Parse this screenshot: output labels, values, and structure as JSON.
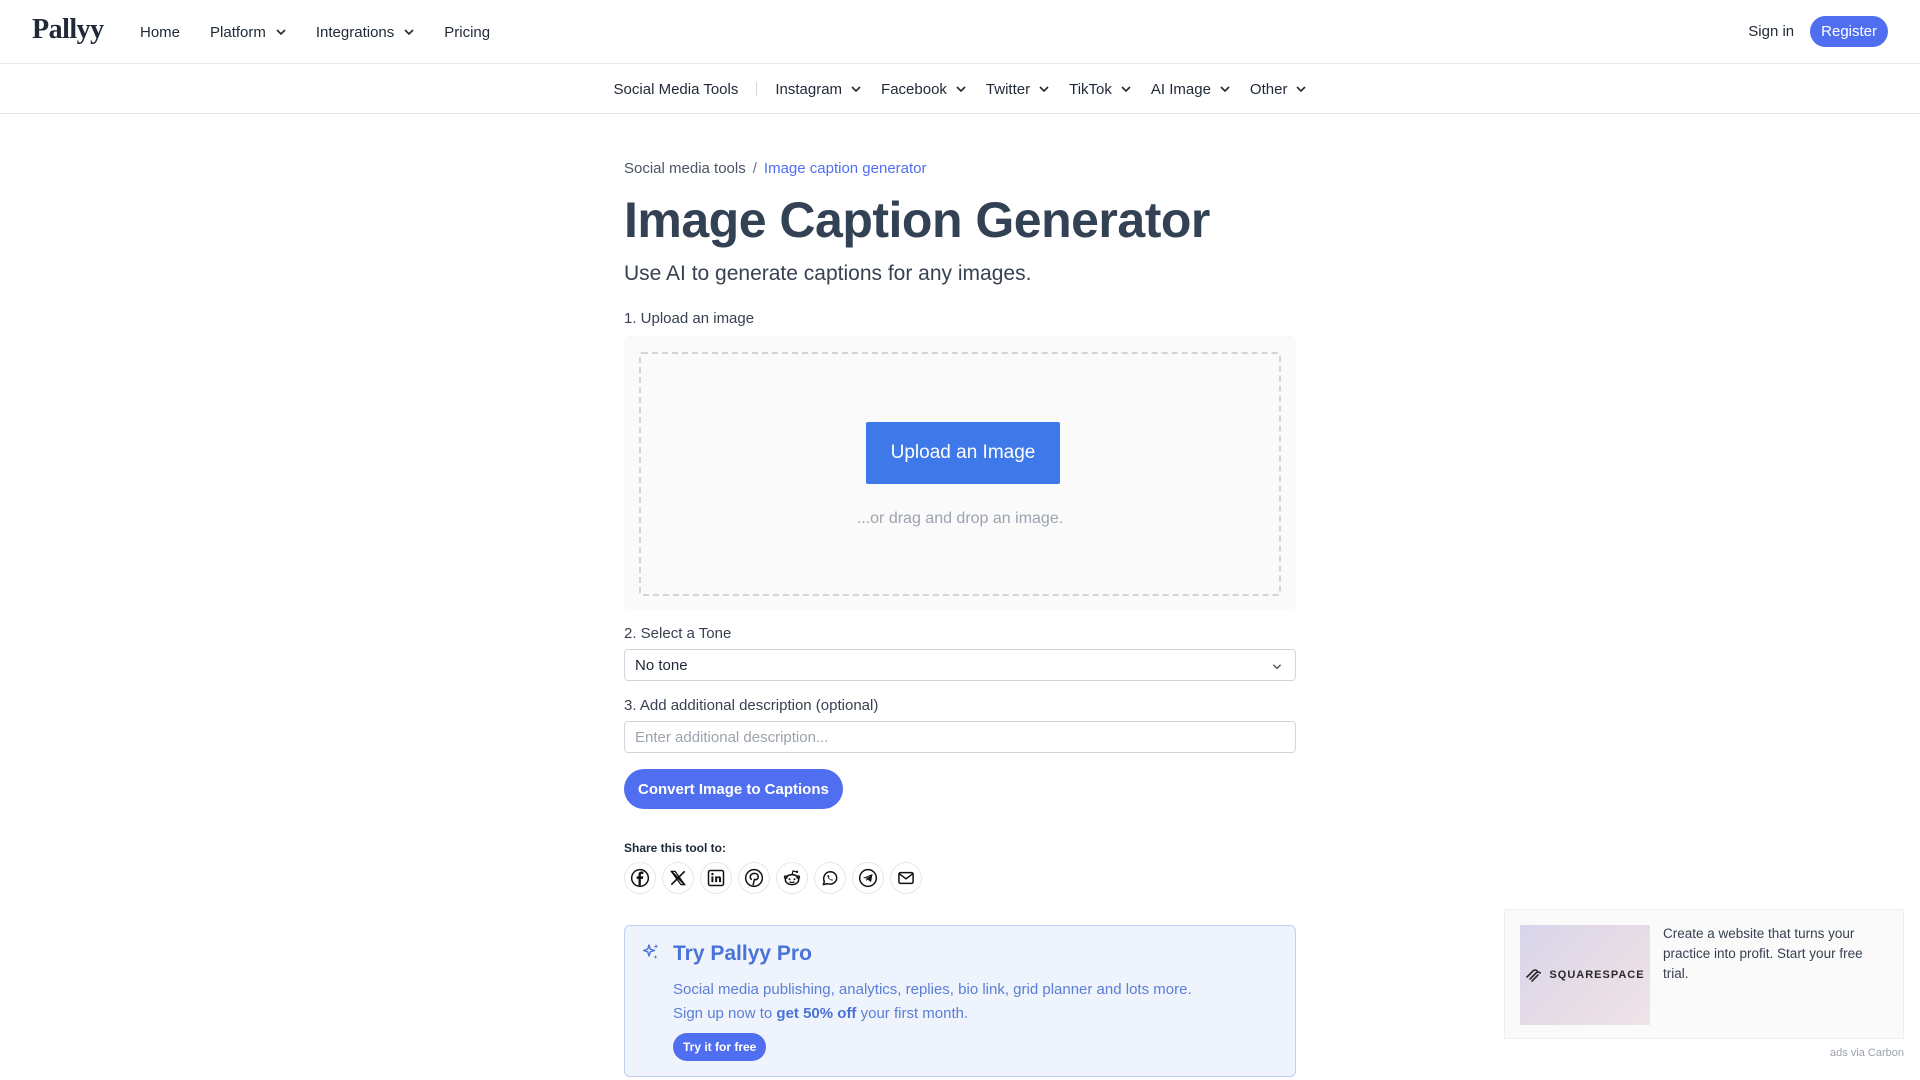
{
  "brand": {
    "logo": "Pallyy"
  },
  "topnav": {
    "items": [
      {
        "label": "Home",
        "dropdown": false
      },
      {
        "label": "Platform",
        "dropdown": true
      },
      {
        "label": "Integrations",
        "dropdown": true
      },
      {
        "label": "Pricing",
        "dropdown": false
      }
    ],
    "sign_in": "Sign in",
    "register": "Register"
  },
  "subnav": {
    "items": [
      {
        "label": "Social Media Tools",
        "dropdown": false
      },
      {
        "label": "Instagram",
        "dropdown": true
      },
      {
        "label": "Facebook",
        "dropdown": true
      },
      {
        "label": "Twitter",
        "dropdown": true
      },
      {
        "label": "TikTok",
        "dropdown": true
      },
      {
        "label": "AI Image",
        "dropdown": true
      },
      {
        "label": "Other",
        "dropdown": true
      }
    ]
  },
  "breadcrumb": {
    "parent": "Social media tools",
    "separator": "/",
    "current": "Image caption generator"
  },
  "page": {
    "title": "Image Caption Generator",
    "subtitle": "Use AI to generate captions for any images."
  },
  "form": {
    "step1_label": "1. Upload an image",
    "upload_button": "Upload an Image",
    "drag_hint": "...or drag and drop an image.",
    "step2_label": "2. Select a Tone",
    "tone_value": "No tone",
    "step3_label": "3. Add additional description (optional)",
    "description_placeholder": "Enter additional description...",
    "description_value": "",
    "convert_button": "Convert Image to Captions"
  },
  "share": {
    "label": "Share this tool to:",
    "icons": [
      "facebook-icon",
      "x-icon",
      "linkedin-icon",
      "pinterest-icon",
      "reddit-icon",
      "whatsapp-icon",
      "telegram-icon",
      "email-icon"
    ]
  },
  "promo": {
    "title": "Try Pallyy Pro",
    "line1": "Social media publishing, analytics, replies, bio link, grid planner and lots more.",
    "line2_prefix": "Sign up now to",
    "line2_bold": "get 50% off",
    "line2_suffix": "your first month.",
    "button": "Try it for free"
  },
  "ad": {
    "brand": "SQUARESPACE",
    "text": "Create a website that turns your practice into profit. Start your free trial.",
    "via": "ads via Carbon"
  },
  "colors": {
    "accent": "#4f6ff0",
    "upload_button": "#3f78e9",
    "promo_bg": "#eef3fc",
    "promo_text": "#4a73d8"
  }
}
